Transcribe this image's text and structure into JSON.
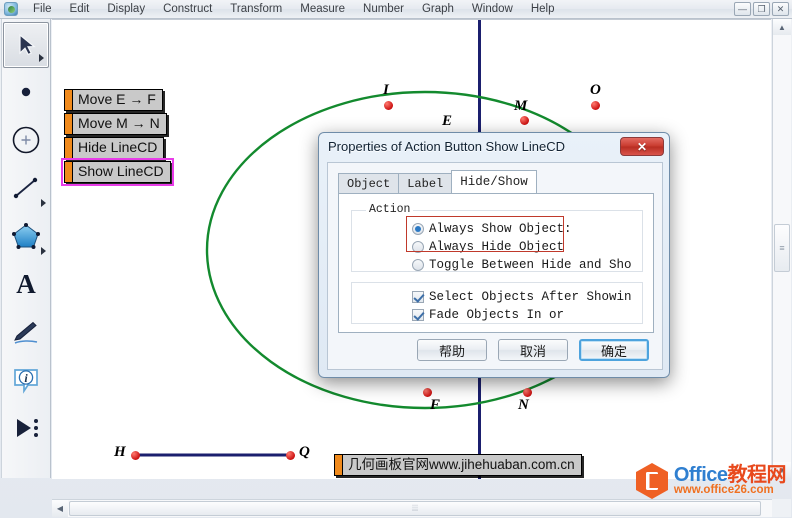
{
  "window": {
    "app_icon": "sketchpad-icon",
    "menus": [
      "File",
      "Edit",
      "Display",
      "Construct",
      "Transform",
      "Measure",
      "Number",
      "Graph",
      "Window",
      "Help"
    ],
    "controls": [
      {
        "name": "minimize-button",
        "glyph": "—"
      },
      {
        "name": "restore-button",
        "glyph": "❐"
      },
      {
        "name": "close-button",
        "glyph": "✕"
      }
    ]
  },
  "toolbar": {
    "tools": [
      {
        "name": "arrow-tool-icon",
        "label": "Selection Arrow",
        "selected": true,
        "has_flyout": true
      },
      {
        "name": "point-tool-icon",
        "label": "Point",
        "selected": false,
        "has_flyout": false
      },
      {
        "name": "compass-tool-icon",
        "label": "Compass",
        "selected": false,
        "has_flyout": false
      },
      {
        "name": "straightedge-tool-icon",
        "label": "Straightedge",
        "selected": false,
        "has_flyout": true
      },
      {
        "name": "polygon-tool-icon",
        "label": "Polygon",
        "selected": false,
        "has_flyout": true
      },
      {
        "name": "text-tool-icon",
        "label": "Text",
        "selected": false,
        "has_flyout": false
      },
      {
        "name": "marker-tool-icon",
        "label": "Marker",
        "selected": false,
        "has_flyout": false
      },
      {
        "name": "information-tool-icon",
        "label": "Information",
        "selected": false,
        "has_flyout": false
      },
      {
        "name": "custom-tool-icon",
        "label": "Custom Tools",
        "selected": false,
        "has_flyout": false
      }
    ]
  },
  "canvas": {
    "action_buttons": [
      {
        "label": "Move E → F",
        "selected": false
      },
      {
        "label": "Move M → N",
        "selected": false
      },
      {
        "label": "Hide LineCD",
        "selected": false
      },
      {
        "label": "Show LineCD",
        "selected": true
      }
    ],
    "watermark_button": {
      "label": "几何画板官网www.jihehuaban.com.cn"
    },
    "point_labels": [
      "I",
      "E",
      "M",
      "O",
      "F",
      "N",
      "H",
      "Q"
    ],
    "colors": {
      "curve": "#138a2e",
      "axis_line": "#1b1f6e",
      "point": "#cc1111",
      "segment": "#1b1f6e",
      "button_grip": "#f08a1c",
      "selection": "#e83ce8"
    }
  },
  "dialog": {
    "title": "Properties of Action Button Show LineCD",
    "close_glyph": "✕",
    "tabs": [
      {
        "label": "Object",
        "active": false
      },
      {
        "label": "Label",
        "active": false
      },
      {
        "label": "Hide/Show",
        "active": true
      }
    ],
    "action_group": {
      "legend": "Action",
      "options": [
        {
          "label": "Always Show Object:",
          "selected": true
        },
        {
          "label": "Always Hide Object",
          "selected": false
        },
        {
          "label": "Toggle Between Hide and Sho",
          "selected": false
        }
      ]
    },
    "checkboxes": [
      {
        "label": "Select Objects After Showin",
        "checked": true
      },
      {
        "label": "Fade Objects In or ",
        "checked": true
      }
    ],
    "buttons": [
      {
        "label": "帮助",
        "primary": false
      },
      {
        "label": "取消",
        "primary": false
      },
      {
        "label": "确定",
        "primary": true
      }
    ]
  },
  "scrollbars": {
    "vertical": {
      "up_glyph": "▲",
      "down_glyph": "▼",
      "thumb_grip": "≡"
    },
    "horizontal": {
      "left_glyph": "◀",
      "right_glyph": "▶",
      "thumb_grip": "⦙⦙⦙"
    }
  },
  "logo": {
    "brand_blue": "Office",
    "brand_red": "教程网",
    "url": "www.office26.com"
  }
}
